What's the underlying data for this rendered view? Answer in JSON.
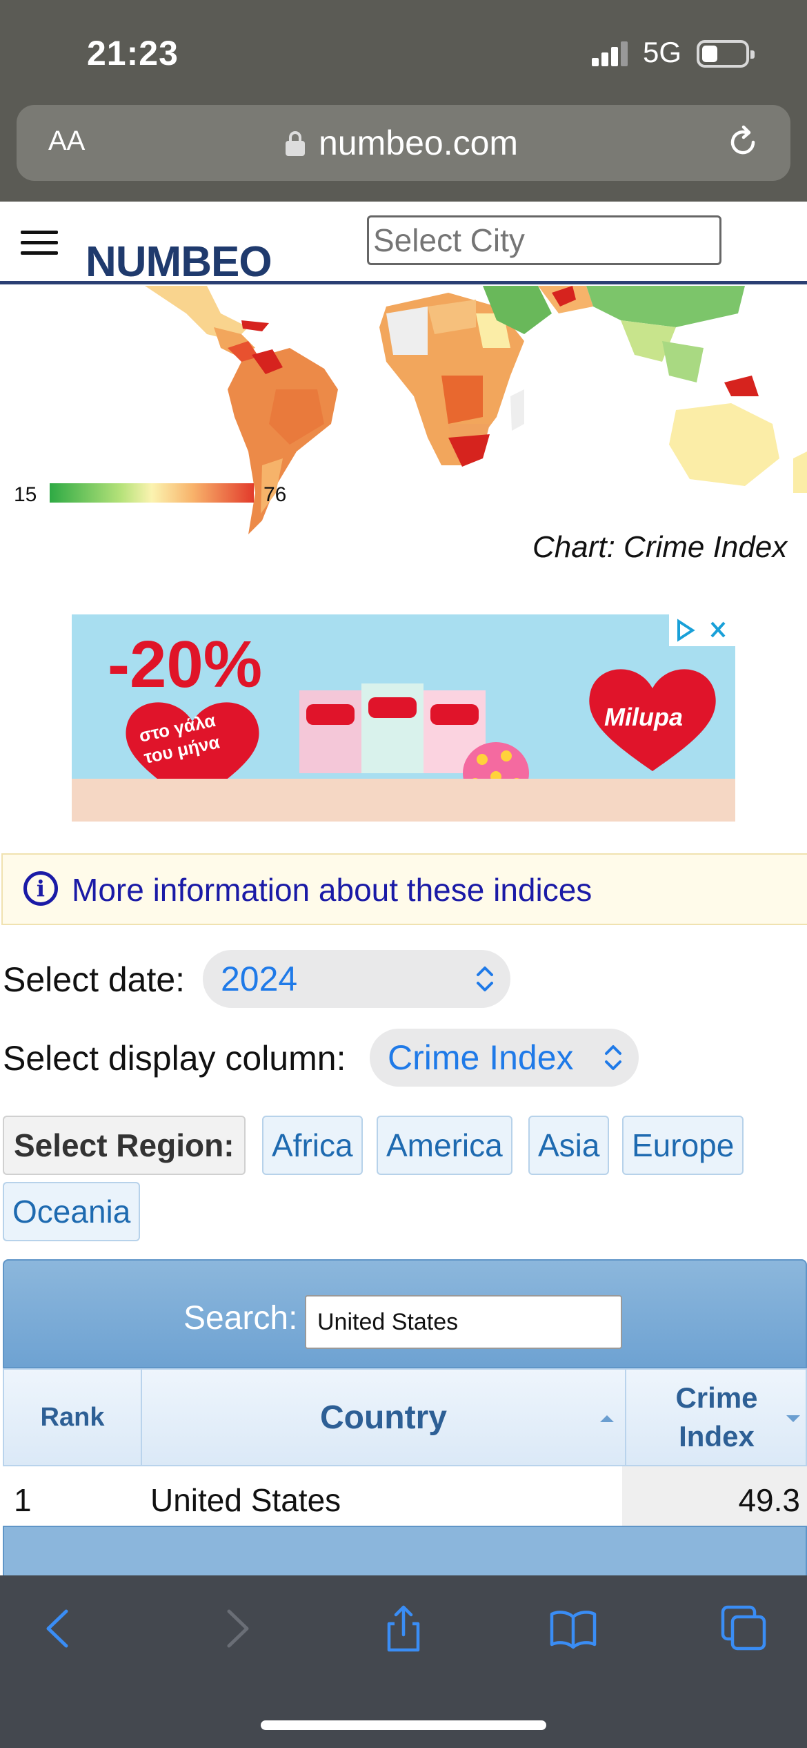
{
  "status_bar": {
    "time": "21:23",
    "network": "5G"
  },
  "browser": {
    "text_size_label": "AA",
    "domain": "numbeo.com"
  },
  "header": {
    "logo": "NUMBEO",
    "city_placeholder": "Select City"
  },
  "map": {
    "legend_min": "15",
    "legend_max": "76",
    "caption": "Chart: Crime Index"
  },
  "ad": {
    "discount": "-20%",
    "left_text_line1": "στο γάλα",
    "left_text_line2": "του μήνα",
    "brand": "Milupa"
  },
  "info": {
    "link_text": "More information about these indices"
  },
  "filters": {
    "date_label": "Select date:",
    "date_value": "2024",
    "column_label": "Select display column:",
    "column_value": "Crime Index",
    "region_label": "Select Region:",
    "regions": [
      "Africa",
      "America",
      "Asia",
      "Europe",
      "Oceania"
    ]
  },
  "table": {
    "search_label": "Search:",
    "search_value": "United States",
    "columns": [
      "Rank",
      "Country",
      "Crime Index"
    ],
    "rows": [
      {
        "rank": "1",
        "country": "United States",
        "crime_index": "49.3"
      }
    ]
  },
  "colors": {
    "accent_blue": "#1f7ae8",
    "logo_navy": "#1f3a6d",
    "link_indigo": "#1a1aa6",
    "ad_red": "#e01428"
  },
  "toolbar_icons": [
    "back-icon",
    "forward-icon",
    "share-icon",
    "bookmarks-icon",
    "tabs-icon"
  ]
}
